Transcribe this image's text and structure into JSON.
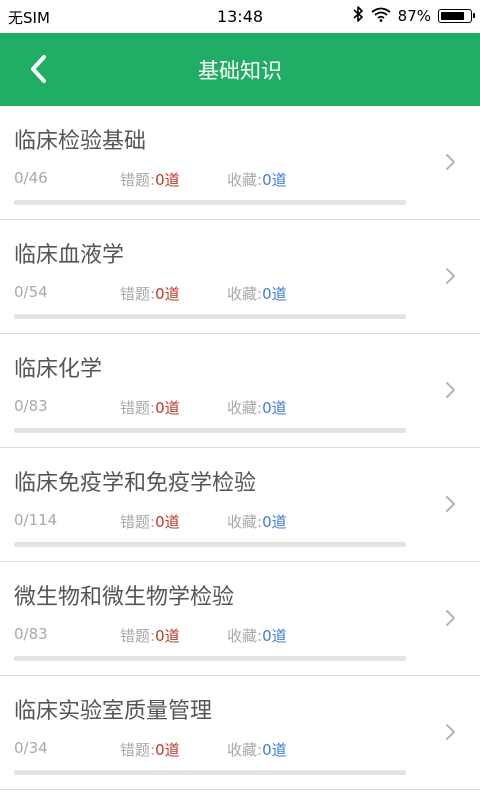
{
  "status_bar": {
    "carrier": "无SIM",
    "time": "13:48",
    "battery": "87%",
    "battery_level": 0.87,
    "icons": [
      "bluetooth-icon",
      "wifi-icon",
      "battery-icon"
    ]
  },
  "header": {
    "title": "基础知识",
    "back_icon": "chevron-left-icon",
    "color": "#1fae63"
  },
  "labels": {
    "wrong": "错题:",
    "favorite": "收藏:"
  },
  "items": [
    {
      "title": "临床检验基础",
      "progress": "0/46",
      "wrong": "0道",
      "favorite": "0道",
      "progress_fraction": 0
    },
    {
      "title": "临床血液学",
      "progress": "0/54",
      "wrong": "0道",
      "favorite": "0道",
      "progress_fraction": 0
    },
    {
      "title": "临床化学",
      "progress": "0/83",
      "wrong": "0道",
      "favorite": "0道",
      "progress_fraction": 0
    },
    {
      "title": "临床免疫学和免疫学检验",
      "progress": "0/114",
      "wrong": "0道",
      "favorite": "0道",
      "progress_fraction": 0
    },
    {
      "title": "微生物和微生物学检验",
      "progress": "0/83",
      "wrong": "0道",
      "favorite": "0道",
      "progress_fraction": 0
    },
    {
      "title": "临床实验室质量管理",
      "progress": "0/34",
      "wrong": "0道",
      "favorite": "0道",
      "progress_fraction": 0
    }
  ]
}
